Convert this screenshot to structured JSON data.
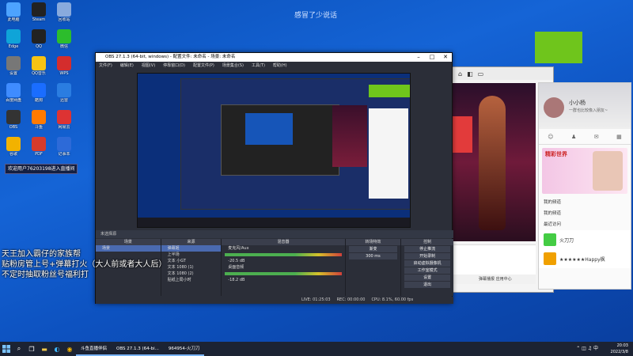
{
  "overlay_text": "感冒了少说话",
  "chat_ticker": "欢迎用户76203198进入直播间",
  "chat_lines": [
    "天王加入霸仔的家族帮",
    "贴粉房管上号+弹幕打火（大人前或者大人后）",
    "不定时抽取粉丝号福利打"
  ],
  "desktop_icons": [
    {
      "label": "此电脑",
      "color": "#4da3ff"
    },
    {
      "label": "Steam",
      "color": "#222"
    },
    {
      "label": "回收站",
      "color": "#88aadd"
    },
    {
      "label": "Edge",
      "color": "#0fa4d8"
    },
    {
      "label": "QQ",
      "color": "#222"
    },
    {
      "label": "微信",
      "color": "#2cbd2c"
    },
    {
      "label": "设置",
      "color": "#777"
    },
    {
      "label": "QQ音乐",
      "color": "#f6c313"
    },
    {
      "label": "WPS",
      "color": "#d42d2d"
    },
    {
      "label": "百度网盘",
      "color": "#3f8cff"
    },
    {
      "label": "酷狗",
      "color": "#1a6dff"
    },
    {
      "label": "迅雷",
      "color": "#2a7de1"
    },
    {
      "label": "OBS",
      "color": "#333"
    },
    {
      "label": "斗鱼",
      "color": "#ff7a00"
    },
    {
      "label": "网易云",
      "color": "#d33"
    },
    {
      "label": "谷歌",
      "color": "#f2b200"
    },
    {
      "label": "PDF",
      "color": "#d63b2b"
    },
    {
      "label": "记事本",
      "color": "#2d6ad8"
    }
  ],
  "obs": {
    "title": "OBS 27.1.3 (64-bit, windows) - 配置文件: 未命名 - 场景: 未命名",
    "menu": [
      "文件(F)",
      "编辑(E)",
      "视图(V)",
      "停靠窗口(D)",
      "配置文件(P)",
      "场景集合(S)",
      "工具(T)",
      "帮助(H)"
    ],
    "source_bar": "未选择源",
    "scenes_header": "场景",
    "scenes": [
      "场景"
    ],
    "sources_header": "来源",
    "sources": [
      "弹幕姬",
      "上半场",
      "文本 小GT",
      "文本 1080 (1)",
      "文本 1080 (2)",
      "贴纸上局小时"
    ],
    "mixer_header": "混音器",
    "mixer": [
      {
        "name": "麦克风/Aux",
        "db": "-20.5 dB"
      },
      {
        "name": "桌面音频",
        "db": "-18.2 dB"
      }
    ],
    "transitions_header": "转场特效",
    "transition": "渐变",
    "duration": "300 ms",
    "controls_header": "控制",
    "controls": [
      "停止推流",
      "开始录制",
      "启动虚拟摄像机",
      "工作室模式",
      "设置",
      "退出"
    ],
    "status": [
      "LIVE: 01:25:03",
      "REC: 00:00:00",
      "CPU: 8.1%, 60.00 fps"
    ]
  },
  "browser": {
    "tab_icons": [
      "home-icon",
      "back-icon",
      "forward-icon"
    ],
    "bottom_text": "弹幕播报  应用中心"
  },
  "chat_panel": {
    "username": "小小杨",
    "subtitle": "一群也比较像入朋友~",
    "promo_title": "精彩世界",
    "items": [
      "我的频道",
      "我的频道",
      "最近访问"
    ],
    "friends": [
      {
        "name": "火刀刀",
        "color": "#4bb34b"
      },
      {
        "name": "★★★★★★Happy枫",
        "color": "#f0a000"
      }
    ]
  },
  "taskbar": {
    "apps": [
      "斗鱼直播伴侣",
      "OBS 27.1.3 (64-bi...",
      "964954-火刀刀"
    ],
    "time": "20:03",
    "date": "2022/3/8"
  }
}
